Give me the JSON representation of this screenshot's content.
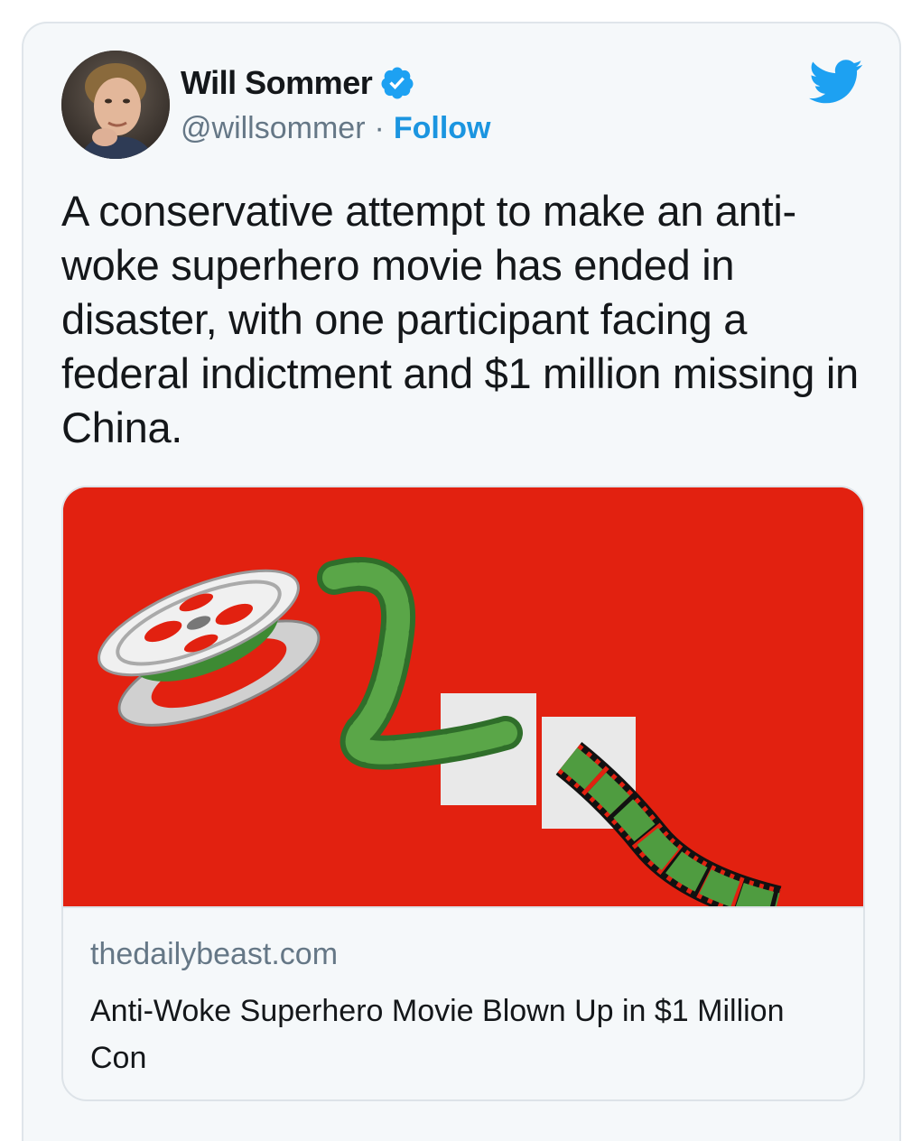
{
  "author": {
    "name": "Will Sommer",
    "handle": "@willsommer",
    "separator": "·",
    "follow_label": "Follow",
    "verified": true
  },
  "tweet": {
    "text": "A conservative attempt to make an anti-woke superhero movie has ended in disaster, with one participant facing a federal indictment and $1 million missing in China."
  },
  "link_card": {
    "domain": "thedailybeast.com",
    "title": "Anti-Woke Superhero Movie Blown Up in $1 Million Con",
    "image_background": "#e22110"
  },
  "colors": {
    "link_blue": "#1b95e0",
    "twitter_blue": "#1da1f2",
    "text_primary": "#14171a",
    "text_secondary": "#657786",
    "card_background": "#f5f8fa"
  },
  "icons": {
    "verified": "verified-badge-icon",
    "brand": "twitter-bird-icon"
  }
}
